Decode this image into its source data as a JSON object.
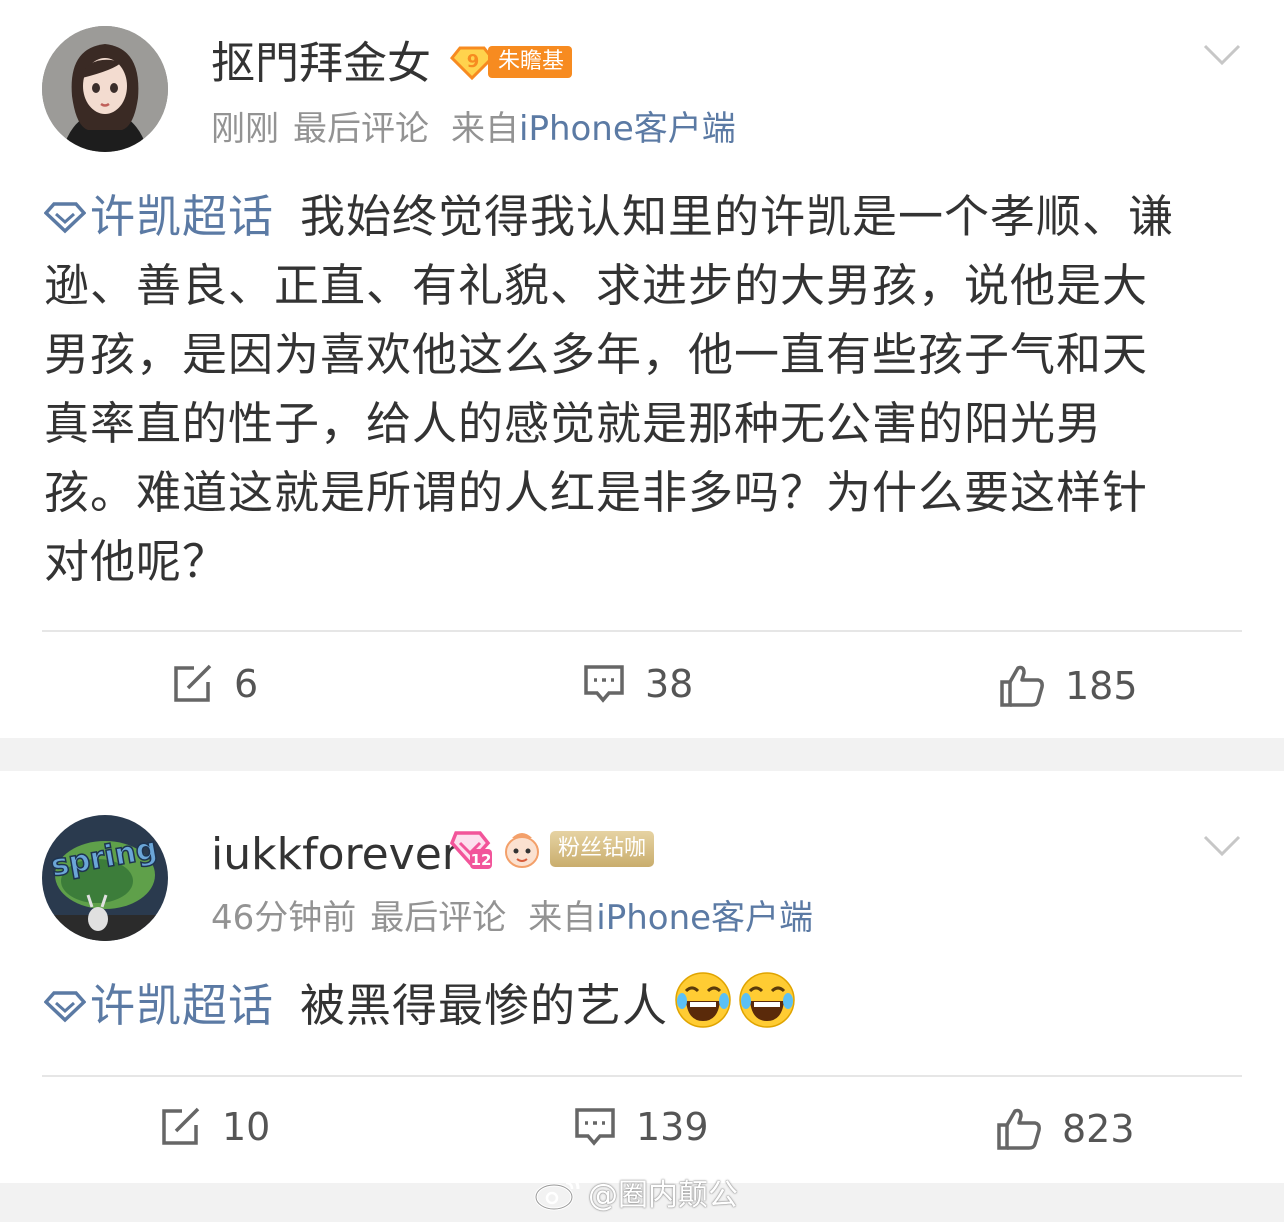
{
  "posts": [
    {
      "username": "抠門拜金女",
      "level": "9",
      "tag": "朱瞻基",
      "time": "刚刚",
      "last_comment": "最后评论",
      "source_prefix": "来自",
      "source": "iPhone客户端",
      "topic": "许凯超话",
      "lines": [
        "我始终觉得我认知里的许凯是一个孝顺、谦",
        "逊、善良、正直、有礼貌、求进步的大男孩，说他是大",
        "男孩，是因为喜欢他这么多年，他一直有些孩子气和天",
        "真率直的性子，给人的感觉就是那种无公害的阳光男",
        "孩。难道这就是所谓的人红是非多吗？为什么要这样针",
        "对他呢？"
      ],
      "reposts": "6",
      "comments": "38",
      "likes": "185"
    },
    {
      "username": "iukkforever",
      "level": "12",
      "fan_tag": "粉丝钻咖",
      "time": "46分钟前",
      "last_comment": "最后评论",
      "source_prefix": "来自",
      "source": "iPhone客户端",
      "topic": "许凯超话",
      "text": "被黑得最惨的艺人",
      "reposts": "10",
      "comments": "139",
      "likes": "823"
    }
  ],
  "avatar2_text": "spring",
  "watermark": "@圈内颠公",
  "colors": {
    "link": "#5b7aa4",
    "meta": "#939393",
    "orange": "#f78b20",
    "pink": "#f2559a"
  },
  "icons": [
    "chevron-down-icon",
    "topic-diamond-icon",
    "repost-icon",
    "comment-icon",
    "like-icon",
    "laughing-emoji-icon",
    "weibo-logo-icon"
  ]
}
